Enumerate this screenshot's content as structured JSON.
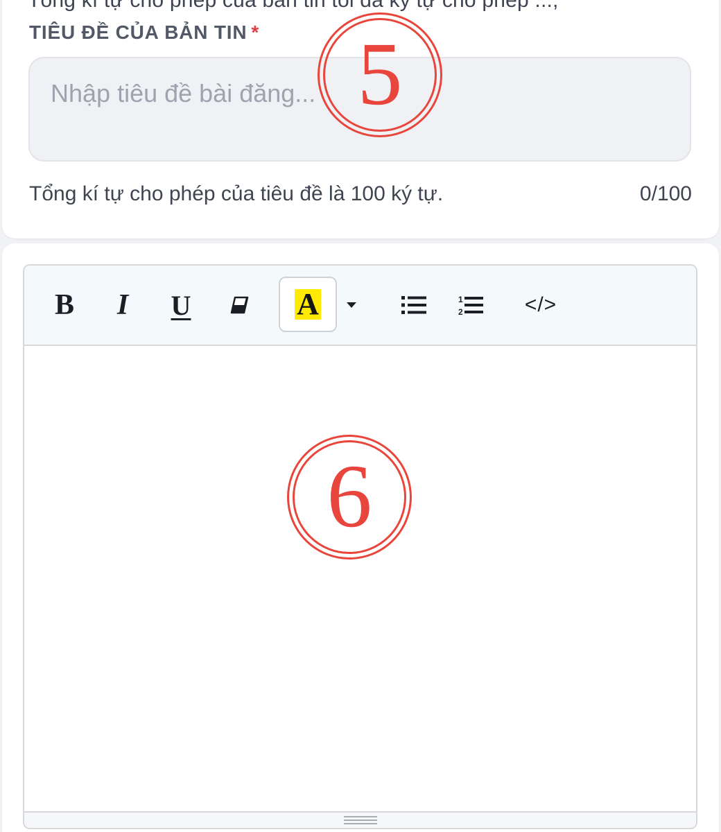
{
  "top_card": {
    "cut_off_text": "Tổng kí tự cho phép của bản tin tối đa ký tự cho phép ...,",
    "label": "TIÊU ĐỀ CỦA BẢN TIN",
    "required_mark": "*",
    "input": {
      "value": "",
      "placeholder": "Nhập tiêu đề bài đăng..."
    },
    "hint": "Tổng kí tự cho phép của tiêu đề là 100 ký tự.",
    "counter": "0/100"
  },
  "annotations": {
    "marker_5": "5",
    "marker_6": "6"
  },
  "editor": {
    "toolbar": {
      "bold": "B",
      "italic": "I",
      "underline": "U",
      "eraser_icon": "eraser-icon",
      "text_color_letter": "A",
      "text_color_highlight": "#ffea00",
      "caret_icon": "caret-down-icon",
      "bullet_list_icon": "bullet-list-icon",
      "numbered_list_icon": "numbered-list-icon",
      "code_view": "</>"
    },
    "content": ""
  },
  "colors": {
    "background": "#f1f2f5",
    "card": "#ffffff",
    "input_bg": "#f0f1f4",
    "required": "#e0404a",
    "annotation": "#e8453c",
    "toolbar_bg": "#f4f9fb"
  }
}
